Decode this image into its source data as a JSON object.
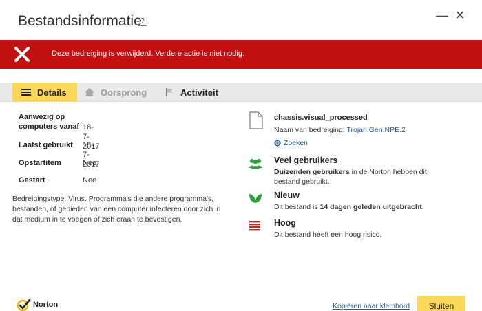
{
  "window": {
    "title": "Bestandsinformatie",
    "help_label": "?",
    "minimize_glyph": "—",
    "close_glyph": "✕"
  },
  "banner": {
    "message": "Deze bedreiging is verwijderd. Verdere actie is niet nodig.",
    "color": "#c20f0f"
  },
  "tabs": [
    {
      "label": "Details",
      "icon": "list-icon",
      "active": true
    },
    {
      "label": "Oorsprong",
      "icon": "home-icon",
      "active": false
    },
    {
      "label": "Activiteit",
      "icon": "flag-icon",
      "active": false
    }
  ],
  "details": {
    "rows": [
      {
        "label": "Aanwezig op computers vanaf",
        "value": "18-7-2017"
      },
      {
        "label": "Laatst gebruikt",
        "value": "18-7-2017"
      },
      {
        "label": "Opstartitem",
        "value": "Nee"
      },
      {
        "label": "Gestart",
        "value": "Nee"
      }
    ],
    "description": "Bedreigingstype: Virus. Programma's die andere programma's, bestanden, of gebieden van een computer infecteren door zich in dat medium in te voegen of zich eraan te bevestigen."
  },
  "file": {
    "name": "chassis.visual_processed",
    "threat_label": "Naam van bedreiging: ",
    "threat_name": "Trojan.Gen.NPE.2",
    "search_label": "Zoeken"
  },
  "info": [
    {
      "icon": "users-icon",
      "title": "Veel gebruikers",
      "text_bold": "Duizenden gebruikers",
      "text_rest": " in de Norton hebben dit bestand gebruikt.",
      "color": "#2e9e3e"
    },
    {
      "icon": "leaf-icon",
      "title": "Nieuw",
      "text_pre": "Dit bestand is ",
      "text_bold": "14 dagen geleden uitgebracht",
      "text_post": ".",
      "color": "#2e9e3e"
    },
    {
      "icon": "risk-bars-icon",
      "title": "Hoog",
      "text": "Dit bestand heeft een hoog risico.",
      "color": "#c62828"
    }
  ],
  "footer": {
    "brand": "Norton",
    "copy_label": "Kopiëren naar klembord",
    "close_label": "Sluiten",
    "accent": "#fbd75a"
  }
}
